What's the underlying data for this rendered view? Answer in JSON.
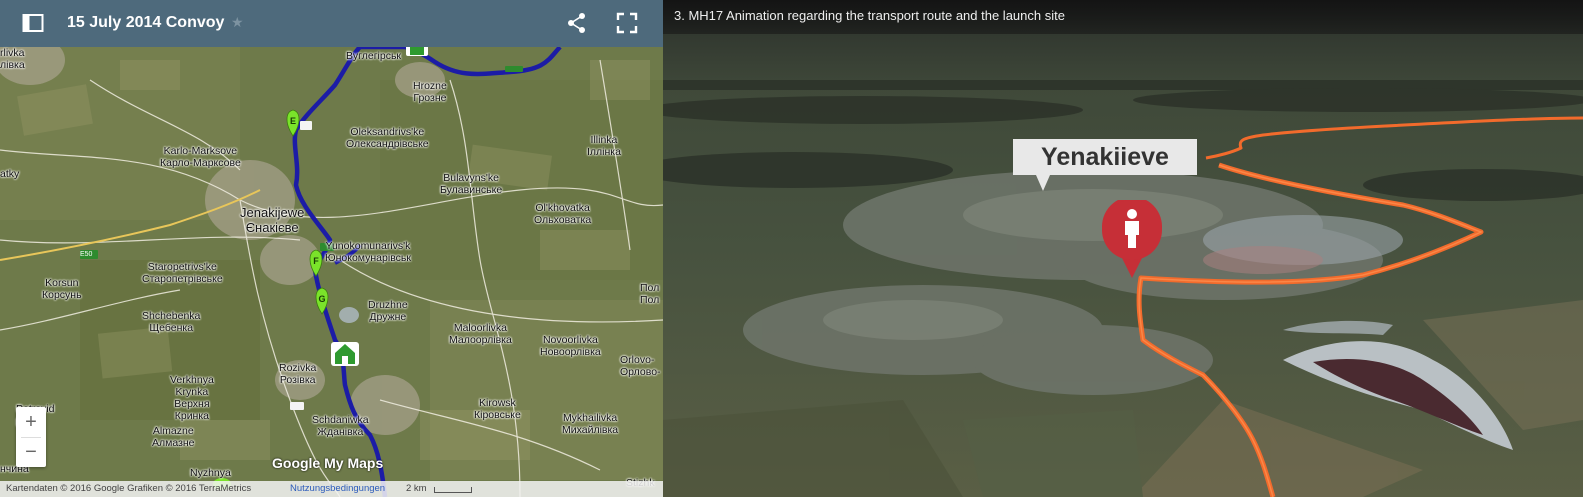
{
  "map": {
    "title": "15 July 2014 Convoy",
    "icons": {
      "sidebar": "sidebar-toggle-icon",
      "star": "star-icon",
      "share": "share-icon",
      "fullscreen": "fullscreen-icon"
    },
    "star_glyph": "★",
    "places": {
      "rlivka": "rlivka\nлівка",
      "vuhlehirsk": "Вуглегірськ",
      "hrozne": "Hrozne\nГрозне",
      "oleksandrivske": "Oleksandrivs'ke\nОлександрівське",
      "illinka": "Illinka\nІллінка",
      "karlo_marksove": "Karlo-Marksove\nКарло-Марксове",
      "bulavynske": "Bulavyns'ke\nБулавинське",
      "olkhovatka": "Ol'khovatka\nОльховатка",
      "jenakijewe": "Jenakijewe\nЄнакієве",
      "yunokomunarivsk": "Yunokomunarivs'k\nЮнокомунарівськ",
      "staropetrivske": "Staropetrivs'ke\nСтаропетрівське",
      "korsun": "Korsun\nКорсунь",
      "shchebenka": "Shchebenka\nЩебенка",
      "druzhne": "Druzhne\nДружне",
      "maloorlivka": "Maloorlivka\nМалоорлівка",
      "novoorlivka": "Novoorlivka\nНовоорлівка",
      "orlovo": "Orlovo-\nОрлово-",
      "rozivka": "Rozivka\nРозівка",
      "verkhnya_krynka": "Verkhnya\nKrynka\nВерхня\nКринка",
      "kirowsk": "Kirowsk\nКіровське",
      "schdaniwka": "Schdaniwka\nЖданівка",
      "almazne": "Almazne\nАлмазне",
      "mykhailivka": "Mykhailivka\nМихайлівка",
      "nyzhnya": "Nyzhnya",
      "stizhk": "Stizhk",
      "petrovid": "Petrovid\nровід",
      "atky": "atky",
      "nchyna": "нчина",
      "pol": "Пол\nПол"
    },
    "route_markers": [
      "E",
      "F",
      "G"
    ],
    "road_label": "E50",
    "zoom_in": "+",
    "zoom_out": "−",
    "logo_text": "Google My Maps",
    "attribution": "Kartendaten © 2016 Google Grafiken © 2016 TerraMetrics",
    "terms_link": "Nutzungsbedingungen",
    "scale_label": "2 km",
    "colors": {
      "header": "#4e6a7c",
      "route": "#1a1a9e",
      "marker": "#7ae32a",
      "home": "#3ba53b"
    }
  },
  "video": {
    "title": "3. MH17 Animation regarding the transport route and the launch site",
    "city_label": "Yenakiieve",
    "pin_icon": "person-pin-icon",
    "colors": {
      "route": "#f26b2c",
      "pin": "#c62f37"
    }
  }
}
